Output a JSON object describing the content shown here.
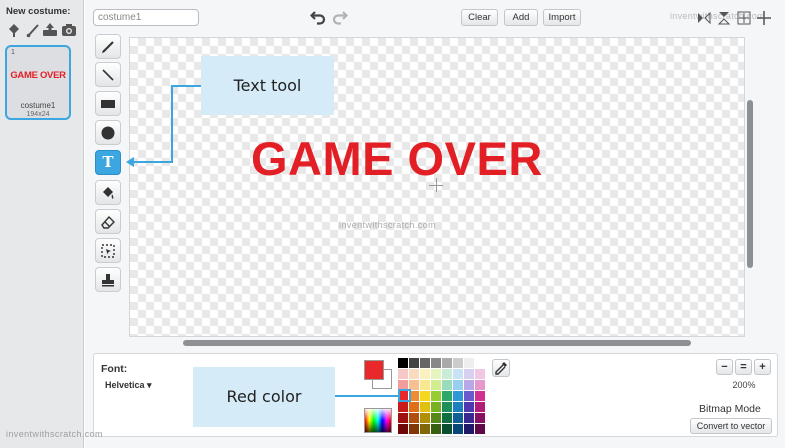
{
  "costume_panel": {
    "new_costume_label": "New costume:",
    "new_costume_icons": [
      "choose-costume-icon",
      "paint-brush-icon",
      "upload-icon",
      "camera-icon"
    ],
    "selected_costume": {
      "index": "1",
      "thumbnail_text": "GAME OVER",
      "name": "costume1",
      "size": "194x24"
    }
  },
  "toolbar_top": {
    "costume_name_value": "costume1",
    "clear_label": "Clear",
    "add_label": "Add",
    "import_label": "Import",
    "watermark": "inventwithscratch.com"
  },
  "tools": [
    "brush-tool",
    "line-tool",
    "rectangle-tool",
    "ellipse-tool",
    "text-tool",
    "fill-tool",
    "eraser-tool",
    "select-tool",
    "stamp-tool"
  ],
  "selected_tool": "text-tool",
  "canvas": {
    "text": "GAME OVER",
    "text_color": "#e31f26",
    "watermark": "inventwithscratch.com"
  },
  "callouts": {
    "text_tool": "Text tool",
    "red_color": "Red color"
  },
  "bottom_panel": {
    "font_label": "Font:",
    "font_value": "Helvetica ▾",
    "foreground_color": "#e8282b",
    "background_color": "#ffffff",
    "zoom_out_label": "−",
    "zoom_reset_label": "=",
    "zoom_in_label": "+",
    "zoom_level": "200%",
    "mode_label": "Bitmap Mode",
    "convert_label": "Convert to vector",
    "watermark": "inventwithscratch.com"
  },
  "palette": [
    "#000000",
    "#444444",
    "#666666",
    "#888888",
    "#aaaaaa",
    "#cccccc",
    "#eeeeee",
    "#ffffff",
    "#f7c8c8",
    "#f9dcc0",
    "#fbf0c0",
    "#e6f4c0",
    "#c8ecd8",
    "#c8e4f4",
    "#d8d0f0",
    "#f0c8e4",
    "#f49c9c",
    "#f6c090",
    "#f8e890",
    "#d2ec90",
    "#98dcbc",
    "#98cef0",
    "#b8a8e8",
    "#e498cc",
    "#e8282b",
    "#f08c30",
    "#f4d820",
    "#98cc30",
    "#2ca868",
    "#2c98d8",
    "#6a5acd",
    "#d03090",
    "#c81c1c",
    "#e07018",
    "#e0c010",
    "#78b020",
    "#1c9058",
    "#1c80c0",
    "#5038b0",
    "#b01c78",
    "#a01010",
    "#b05010",
    "#b09008",
    "#588818",
    "#107040",
    "#106098",
    "#382890",
    "#881060",
    "#700808",
    "#803808",
    "#806808",
    "#386010",
    "#085030",
    "#084878",
    "#201868",
    "#600848"
  ]
}
